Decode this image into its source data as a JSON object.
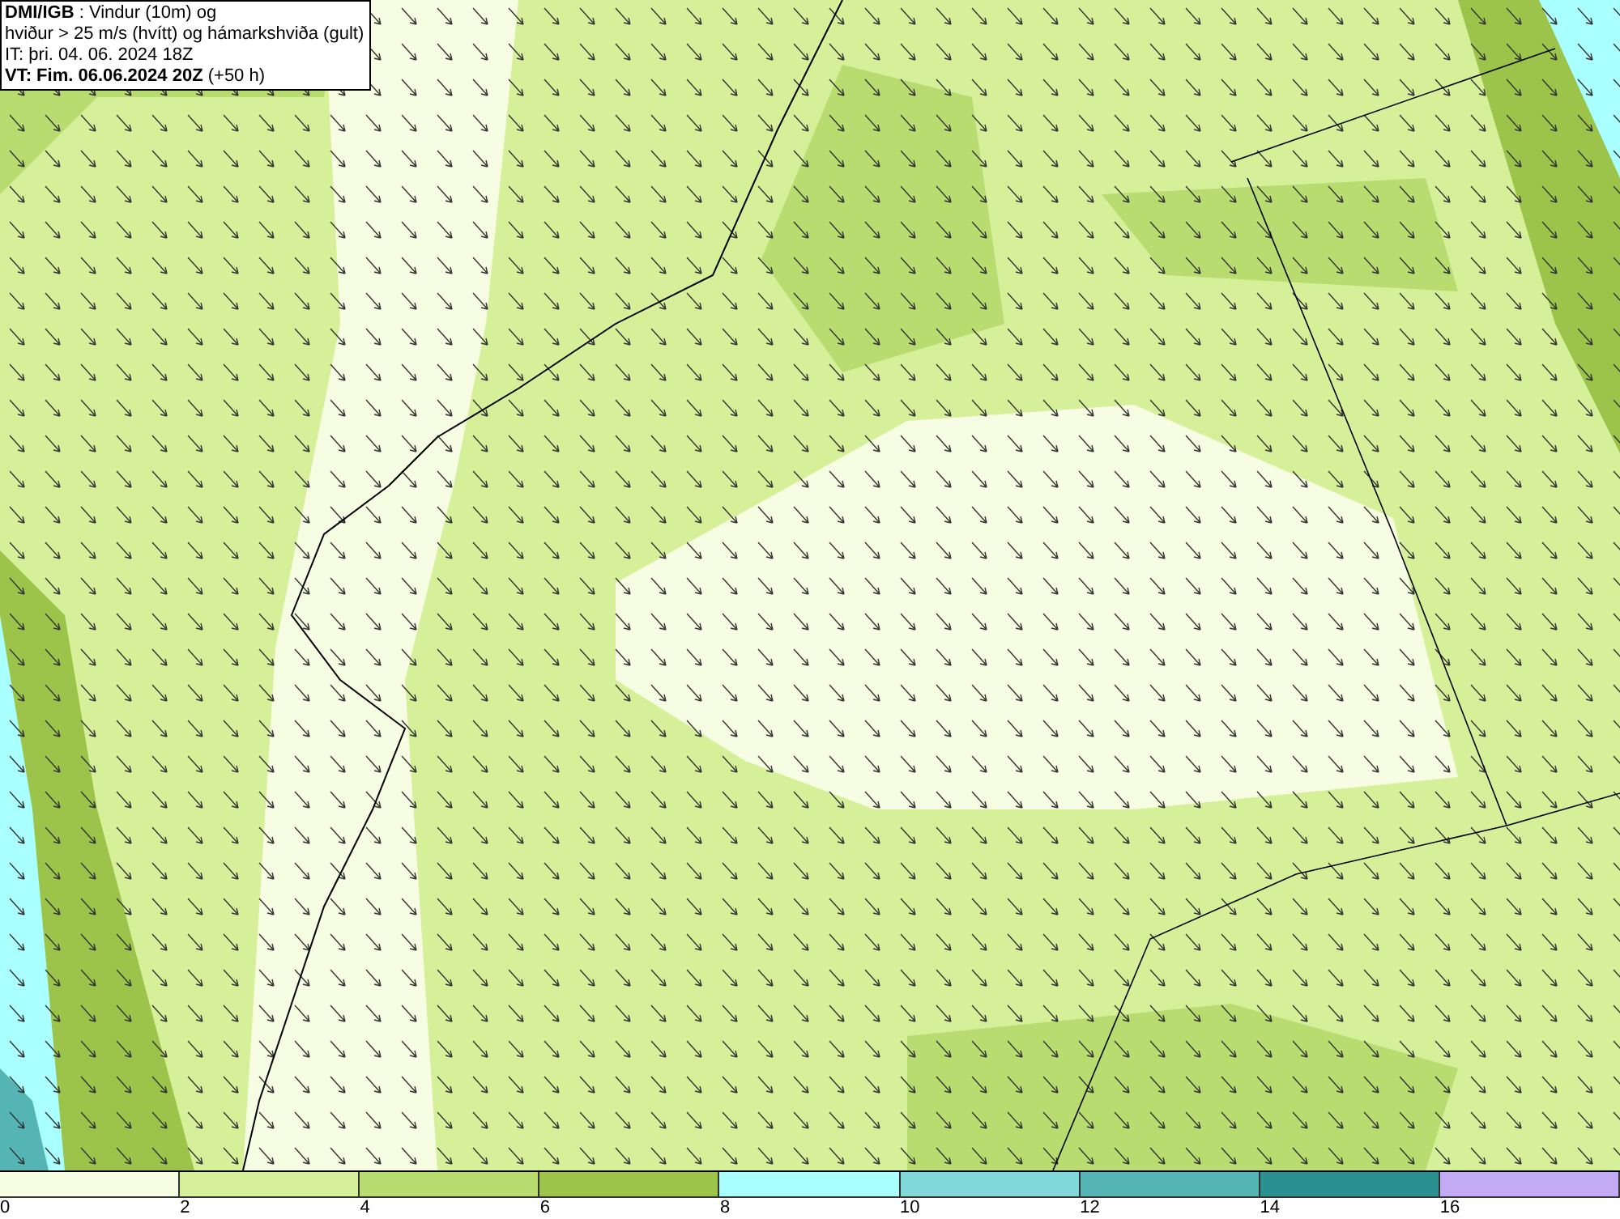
{
  "title_box": {
    "lines": [
      "**DMI/IGB** : Vindur (10m) og",
      "hviður > 25 m/s (hvítt) og hámarkshviða (gult)",
      "IT: þri. 04. 06. 2024 18Z",
      "**VT: Fim. 06.06.2024 20Z** (+50 h)"
    ]
  },
  "legend": {
    "bins": [
      {
        "label": "0",
        "color": "#f6fde2"
      },
      {
        "label": "2",
        "color": "#d6f09a"
      },
      {
        "label": "4",
        "color": "#b9dc70"
      },
      {
        "label": "6",
        "color": "#9cc44a"
      },
      {
        "label": "8",
        "color": "#aaffff"
      },
      {
        "label": "10",
        "color": "#80d8d8"
      },
      {
        "label": "12",
        "color": "#55b5b5"
      },
      {
        "label": "14",
        "color": "#2a9090"
      },
      {
        "label": "16",
        "color": "#c2aaf4"
      }
    ]
  }
}
